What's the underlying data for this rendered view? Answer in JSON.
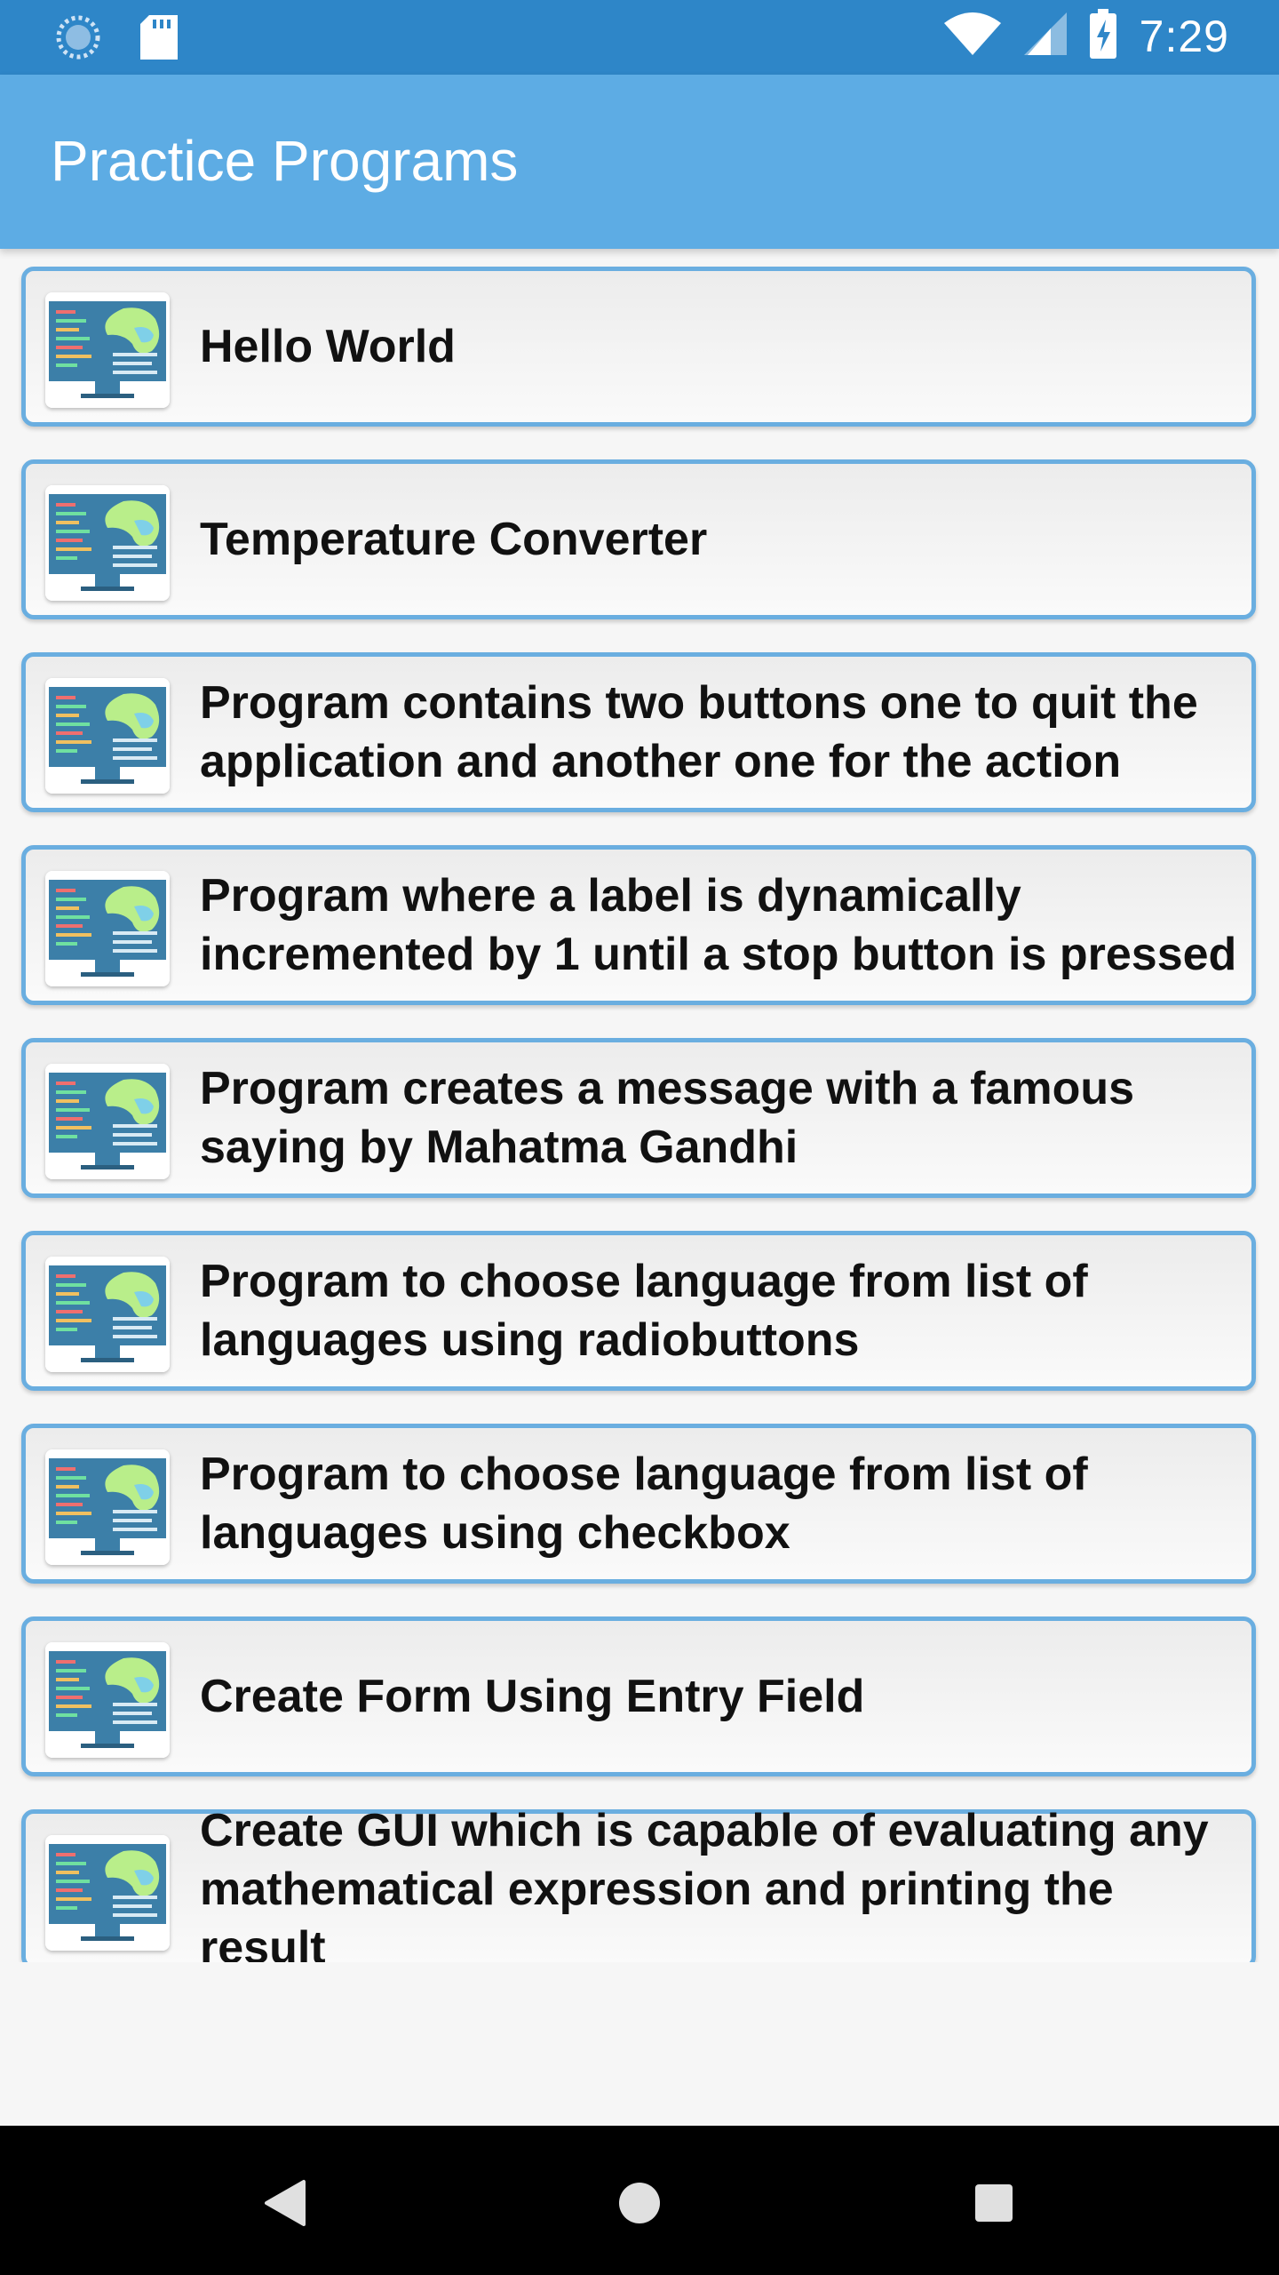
{
  "status_bar": {
    "time": "7:29",
    "icons": [
      "sync-icon",
      "sd-card-icon",
      "wifi-icon",
      "signal-icon",
      "battery-charging-icon"
    ]
  },
  "app_bar": {
    "title": "Practice Programs"
  },
  "programs": [
    {
      "title": "Hello World",
      "icon": "code-monitor-icon"
    },
    {
      "title": "Temperature Converter",
      "icon": "code-monitor-icon"
    },
    {
      "title": "Program contains two buttons one to quit the application and another one for the action",
      "icon": "code-monitor-icon"
    },
    {
      "title": "Program where a label is dynamically incremented by 1 until a stop button is pressed",
      "icon": "code-monitor-icon"
    },
    {
      "title": "Program creates a message with a famous saying by Mahatma Gandhi",
      "icon": "code-monitor-icon"
    },
    {
      "title": "Program to choose language from list of languages using radiobuttons",
      "icon": "code-monitor-icon"
    },
    {
      "title": "Program to choose language from list of languages using checkbox",
      "icon": "code-monitor-icon"
    },
    {
      "title": "Create Form Using Entry Field",
      "icon": "code-monitor-icon"
    },
    {
      "title": "Create GUI which is capable of evaluating any mathematical expression and printing the result",
      "icon": "code-monitor-icon"
    }
  ],
  "nav_bar": {
    "icons": [
      "back-icon",
      "home-icon",
      "recents-icon"
    ]
  },
  "colors": {
    "status_bar": "#2e86c8",
    "app_bar": "#5dace4",
    "card_border": "#6aaee0",
    "nav_bar": "#000000"
  }
}
